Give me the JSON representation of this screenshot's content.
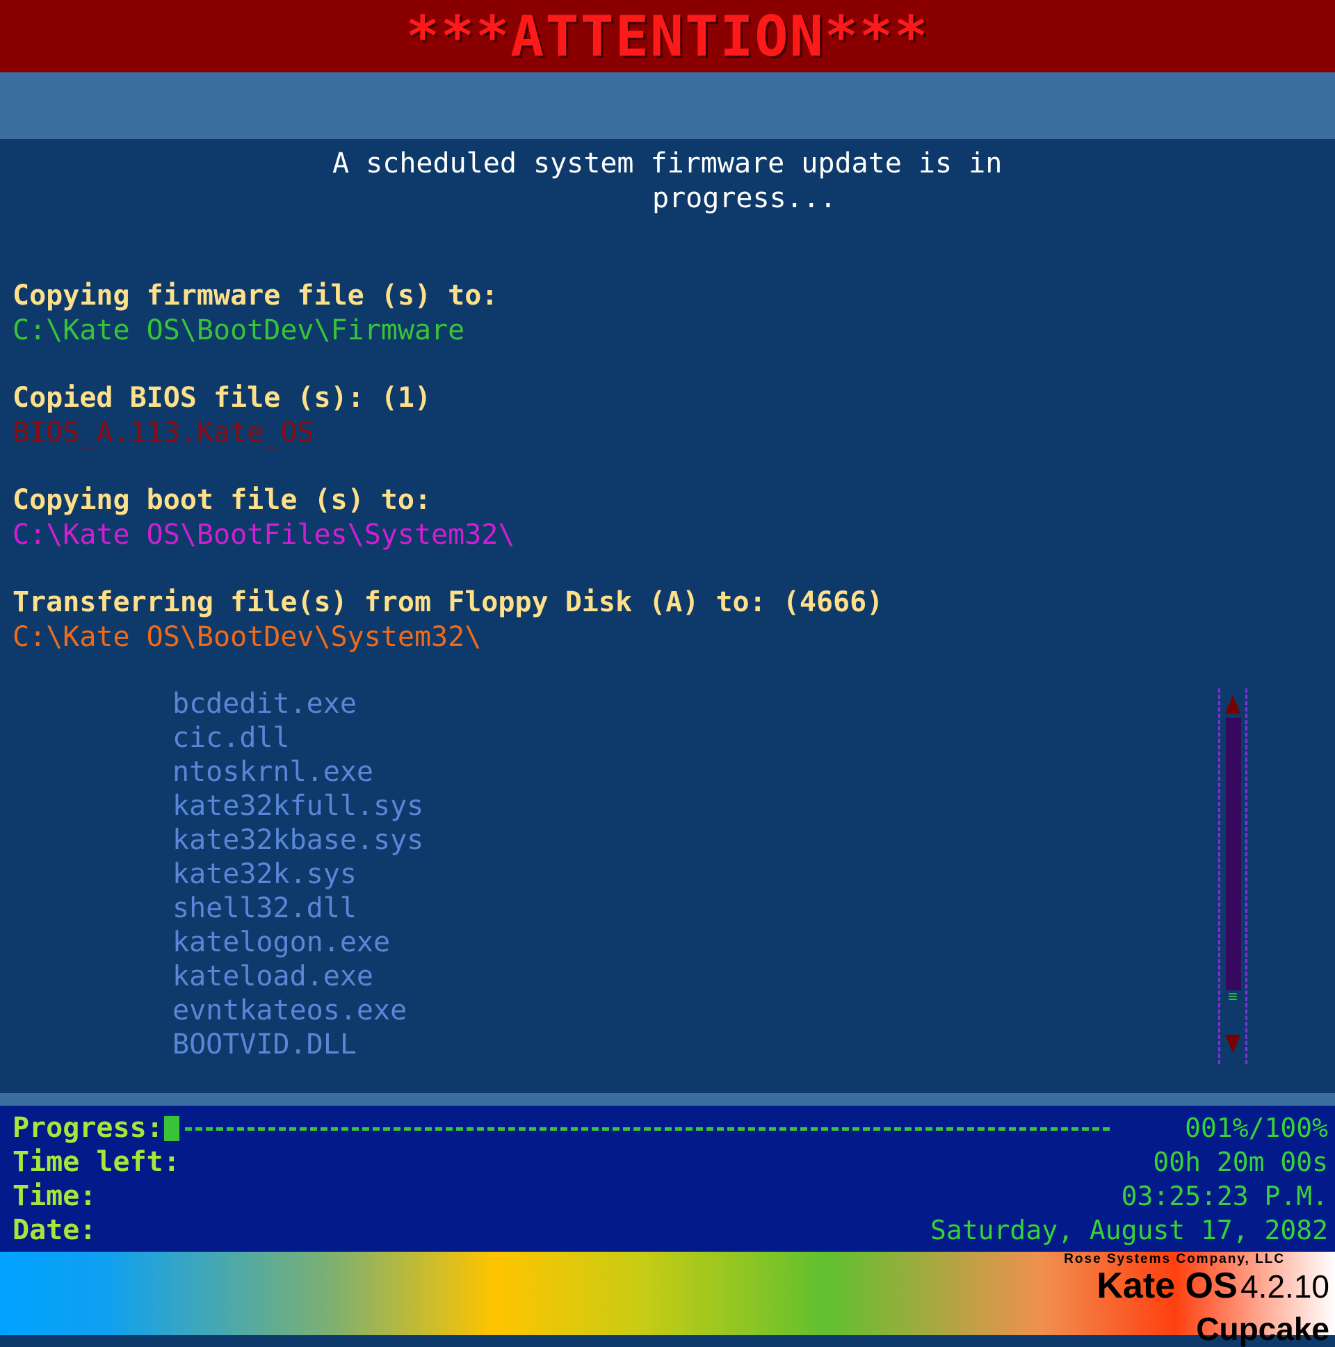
{
  "title": "***ATTENTION***",
  "status_message": {
    "line1": "A scheduled system firmware update is in",
    "line2": "progress..."
  },
  "sections": {
    "firmware": {
      "heading": "Copying firmware file (s) to:",
      "path": "C:\\Kate OS\\BootDev\\Firmware"
    },
    "bios": {
      "heading": "Copied BIOS file (s): (1)",
      "path": "BIOS_A.113.Kate_OS"
    },
    "boot": {
      "heading": "Copying boot file (s) to:",
      "path": "C:\\Kate OS\\BootFiles\\System32\\"
    },
    "floppy": {
      "heading": "Transferring file(s) from Floppy Disk (A) to: (4666)",
      "path": "C:\\Kate OS\\BootDev\\System32\\"
    }
  },
  "files": [
    "bcdedit.exe",
    "cic.dll",
    "ntoskrnl.exe",
    "kate32kfull.sys",
    "kate32kbase.sys",
    "kate32k.sys",
    "shell32.dll",
    "katelogon.exe",
    "kateload.exe",
    "evntkateos.exe",
    "BOOTVID.DLL"
  ],
  "status": {
    "progress_label": "Progress:",
    "progress_value": "001%/100%",
    "progress_fraction": 0.01,
    "time_left_label": "Time left:",
    "time_left_value": "00h 20m 00s",
    "time_label": "Time:",
    "time_value": "03:25:23 P.M.",
    "date_label": "Date:",
    "date_value": "Saturday, August 17, 2082"
  },
  "branding": {
    "company": "Rose Systems Company, LLC",
    "product": "Kate OS",
    "version": "4.2.10",
    "codename": "Cupcake"
  },
  "icons": {
    "scroll_up": "triangle-up-icon",
    "scroll_down": "triangle-down-icon",
    "scroll_grip": "grip-lines-icon"
  },
  "colors": {
    "title_bg": "#8a0000",
    "title_text": "#ff1a1a",
    "main_bg": "#0d3a6a",
    "band": "#3c6ea1",
    "heading": "#ffe08a",
    "firmware_path": "#39c339",
    "bios_path": "#8c0c12",
    "boot_path": "#d21ed2",
    "floppy_path": "#f06a1a",
    "file_text": "#5a86d8",
    "status_bg": "#021a8a",
    "status_label": "#a8e63c",
    "status_value": "#38d238"
  }
}
